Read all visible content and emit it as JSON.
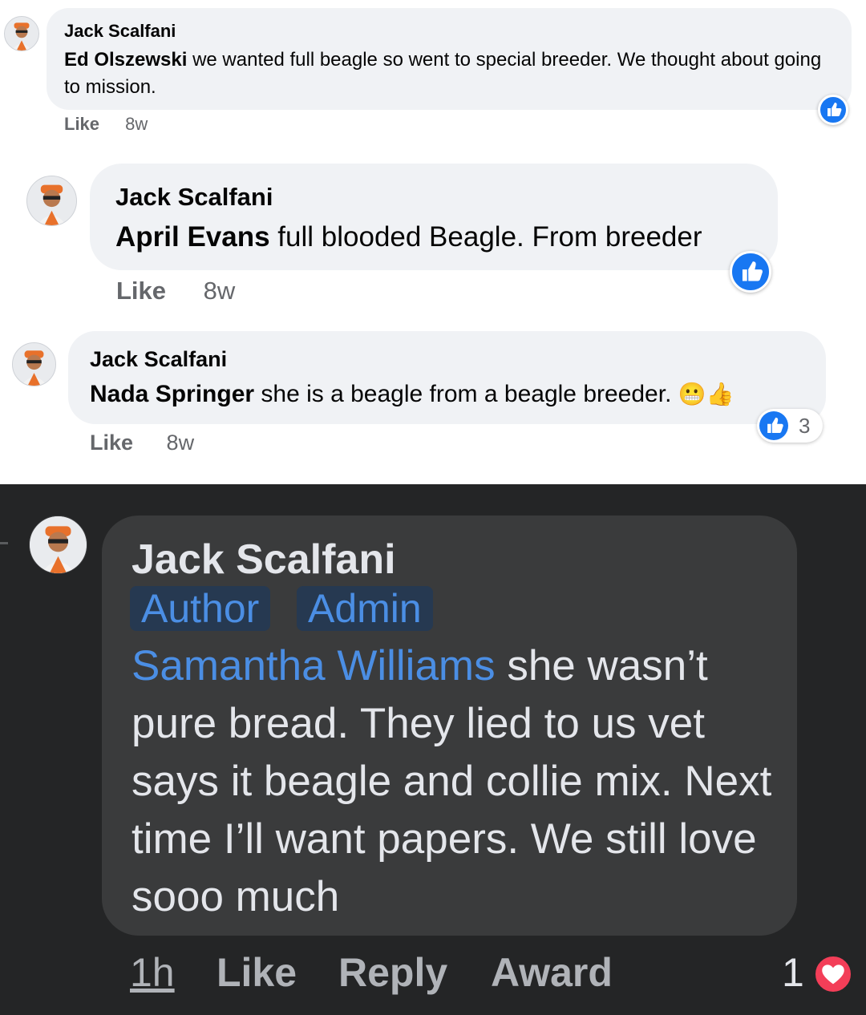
{
  "comments": [
    {
      "author": "Jack Scalfani",
      "mention": "Ed Olszewski",
      "text": " we wanted full beagle so went to special breeder. We thought about going to mission.",
      "like_label": "Like",
      "time": "8w"
    },
    {
      "author": "Jack Scalfani",
      "mention": "April Evans",
      "text": " full blooded Beagle. From breeder",
      "like_label": "Like",
      "time": "8w"
    },
    {
      "author": "Jack Scalfani",
      "mention": "Nada Springer",
      "text": " she is a beagle from a beagle breeder.",
      "emoji_grimace": "😬",
      "emoji_thumbs": "👍",
      "like_label": "Like",
      "time": "8w",
      "reaction_count": "3"
    }
  ],
  "dark_comment": {
    "author": "Jack Scalfani",
    "badges": [
      "Author",
      "Admin"
    ],
    "mention": "Samantha Williams",
    "text": " she wasn’t pure bread. They lied to us vet says it beagle and collie mix. Next time I’ll want papers. We still love sooo much",
    "time": "1h",
    "like_label": "Like",
    "reply_label": "Reply",
    "award_label": "Award",
    "reaction_count": "1"
  },
  "colors": {
    "like_blue": "#1877f2",
    "love_red": "#f33e58",
    "mention_blue": "#4b8ee4"
  },
  "icons": [
    "avatar-image",
    "like-reaction-icon",
    "love-reaction-icon"
  ]
}
